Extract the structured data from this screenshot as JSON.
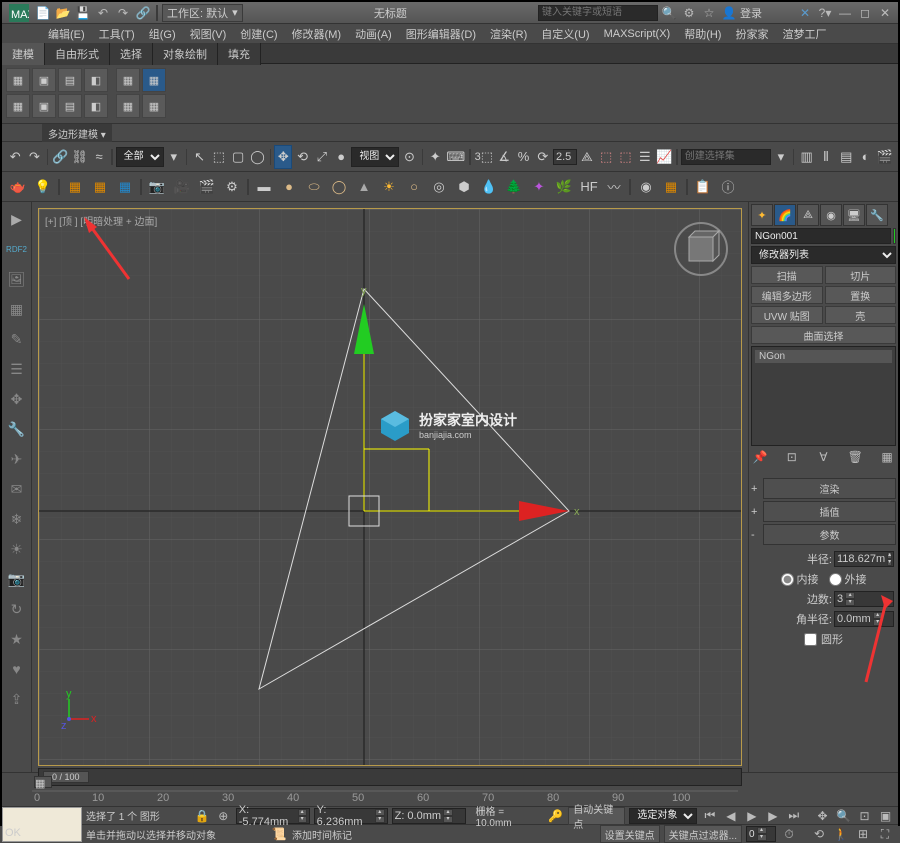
{
  "title_center": "无标题",
  "workspace_label": "工作区: 默认",
  "search_placeholder": "键入关键字或短语",
  "login_label": "登录",
  "menus": [
    "编辑(E)",
    "工具(T)",
    "组(G)",
    "视图(V)",
    "创建(C)",
    "修改器(M)",
    "动画(A)",
    "图形编辑器(D)",
    "渲染(R)",
    "自定义(U)",
    "MAXScript(X)",
    "帮助(H)",
    "扮家家",
    "渲梦工厂"
  ],
  "tabs": [
    "建模",
    "自由形式",
    "选择",
    "对象绘制",
    "填充"
  ],
  "tab_active": 0,
  "mode_label": "多边形建模 ▾",
  "filter_all": "全部",
  "view_label": "视图",
  "selset_placeholder": "创建选择集",
  "angle_val": "2.5",
  "viewport_label": "[+] [顶 ] [明暗处理 + 边面]",
  "left_text": "RDF2",
  "watermark_top": "扮家家室内设计",
  "watermark_sub": "banjiajia.com",
  "slider_pos": "0 / 100",
  "object_name": "NGon001",
  "modlist_label": "修改器列表",
  "mod_buttons": [
    [
      "扫描",
      "切片"
    ],
    [
      "编辑多边形",
      "置换"
    ],
    [
      "UVW 贴图",
      "壳"
    ]
  ],
  "mod_button_wide": "曲面选择",
  "stack_item": "NGon",
  "rollouts": {
    "render": "渲染",
    "interp": "插值",
    "params": "参数"
  },
  "param_radius_label": "半径:",
  "param_radius_val": "118.627m",
  "param_inscribed": "内接",
  "param_circumscribed": "外接",
  "param_sides_label": "边数:",
  "param_sides_val": "3",
  "param_cornerrad_label": "角半径:",
  "param_cornerrad_val": "0.0mm",
  "param_circular": "圆形",
  "status_sel": "选择了 1 个 图形",
  "status_hint": "单击并拖动以选择并移动对象",
  "coord_x": "X: -5.774mm",
  "coord_y": "Y: 6.236mm",
  "coord_z": "Z: 0.0mm",
  "grid_label": "栅格 = 10.0mm",
  "autokey": "自动关键点",
  "selobj": "选定对象",
  "setkey": "设置关键点",
  "keyfilter": "关键点过滤器...",
  "addtime": "添加时间标记",
  "prompt_text": "OK"
}
